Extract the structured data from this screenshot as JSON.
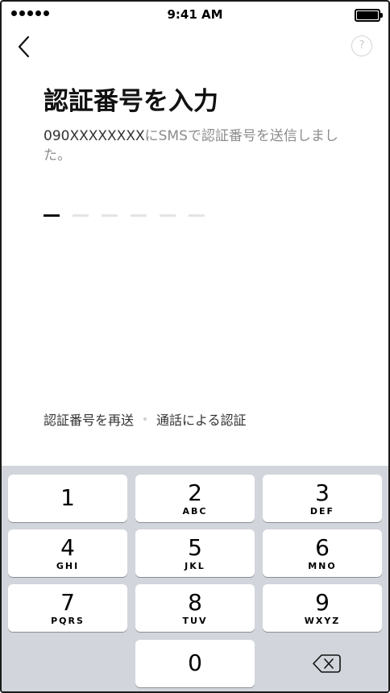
{
  "status_bar": {
    "time": "9:41 AM"
  },
  "header": {
    "title": "認証番号を入力",
    "help_label": "?"
  },
  "message": {
    "phone": "090XXXXXXXX",
    "text": "にSMSで認証番号を送信しました。"
  },
  "code": {
    "length": 6,
    "filled": 0
  },
  "links": {
    "resend": "認証番号を再送",
    "call": "通話による認証"
  },
  "keypad": {
    "keys": [
      {
        "digit": "1",
        "letters": ""
      },
      {
        "digit": "2",
        "letters": "ABC"
      },
      {
        "digit": "3",
        "letters": "DEF"
      },
      {
        "digit": "4",
        "letters": "GHI"
      },
      {
        "digit": "5",
        "letters": "JKL"
      },
      {
        "digit": "6",
        "letters": "MNO"
      },
      {
        "digit": "7",
        "letters": "PQRS"
      },
      {
        "digit": "8",
        "letters": "TUV"
      },
      {
        "digit": "9",
        "letters": "WXYZ"
      },
      {
        "digit": "0",
        "letters": ""
      }
    ]
  }
}
